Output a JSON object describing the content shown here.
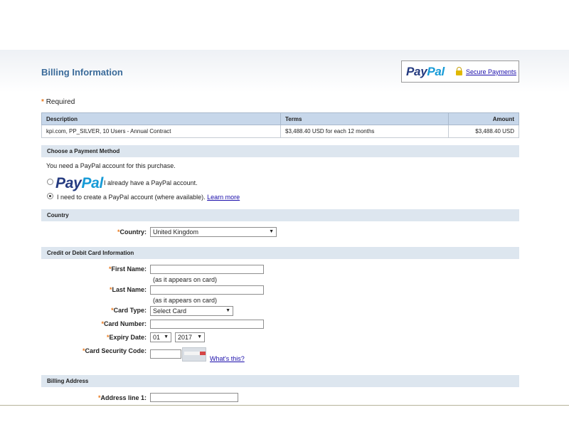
{
  "header": {
    "title": "Billing Information",
    "paypal_logo": {
      "pay": "Pay",
      "pal": "Pal"
    },
    "secure_link": "Secure Payments"
  },
  "required_note": "Required",
  "order_table": {
    "headers": [
      "Description",
      "Terms",
      "Amount"
    ],
    "rows": [
      {
        "description": "kpi.com, PP_SILVER, 10 Users - Annual Contract",
        "terms": "$3,488.40 USD for each 12 months",
        "amount": "$3,488.40 USD"
      }
    ]
  },
  "payment_method": {
    "section_title": "Choose a Payment Method",
    "intro": "You need a PayPal account for this purchase.",
    "option_existing": "I already have a PayPal account.",
    "option_create": "I need to create a PayPal account (where available).",
    "learn_more": "Learn more",
    "selected": "create"
  },
  "country": {
    "section_title": "Country",
    "label": "Country:",
    "value": "United Kingdom"
  },
  "card": {
    "section_title": "Credit or Debit Card Information",
    "first_name_label": "First Name:",
    "first_name_hint": "(as it appears on card)",
    "last_name_label": "Last Name:",
    "last_name_hint": "(as it appears on card)",
    "card_type_label": "Card Type:",
    "card_type_value": "Select Card",
    "card_number_label": "Card Number:",
    "expiry_label": "Expiry Date:",
    "expiry_month": "01",
    "expiry_year": "2017",
    "security_label": "Card Security Code:",
    "whats_this": "What's this?"
  },
  "billing": {
    "section_title": "Billing Address",
    "address1_label": "Address line 1:"
  },
  "colors": {
    "accent": "#3b6b9a",
    "section_bg": "#dde6ef",
    "table_header": "#c7d7ea",
    "required": "#e8791f",
    "link": "#1a0dab"
  }
}
